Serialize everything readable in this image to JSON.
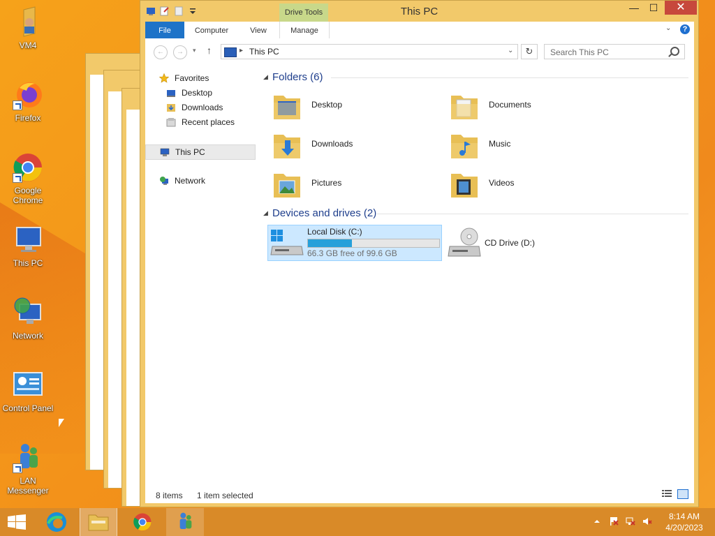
{
  "desktop": {
    "icons": [
      {
        "label": "VM4"
      },
      {
        "label": "Firefox"
      },
      {
        "label": "Google Chrome"
      },
      {
        "label": "This PC"
      },
      {
        "label": "Network"
      },
      {
        "label": "Control Panel"
      },
      {
        "label": "LAN Messenger"
      }
    ]
  },
  "window": {
    "title": "This PC",
    "contextual_tab": "Drive Tools",
    "controls": {
      "minimize": "—",
      "maximize": "☐",
      "close": "✕"
    },
    "ribbon_tabs": [
      "File",
      "Computer",
      "View",
      "Manage"
    ],
    "help": "?"
  },
  "address": {
    "path": "This PC",
    "search_placeholder": "Search This PC"
  },
  "navpane": {
    "favorites": "Favorites",
    "favorites_items": [
      "Desktop",
      "Downloads",
      "Recent places"
    ],
    "this_pc": "This PC",
    "network": "Network"
  },
  "main": {
    "folders_header": "Folders (6)",
    "folders": [
      "Desktop",
      "Documents",
      "Downloads",
      "Music",
      "Pictures",
      "Videos"
    ],
    "drives_header": "Devices and drives (2)",
    "drives": [
      {
        "name": "Local Disk (C:)",
        "free_text": "66.3 GB free of 99.6 GB",
        "used_fraction": 0.334,
        "selected": true
      },
      {
        "name": "CD Drive (D:)"
      }
    ]
  },
  "status": {
    "count": "8 items",
    "selection": "1 item selected"
  },
  "taskbar": {
    "time": "8:14 AM",
    "date": "4/20/2023"
  },
  "colors": {
    "desktop": "#f3921a",
    "window_frame": "#f2c96a",
    "accent": "#1e73c8",
    "selection": "#cce8ff",
    "drive_bar": "#26a0da",
    "close": "#c7483c"
  }
}
